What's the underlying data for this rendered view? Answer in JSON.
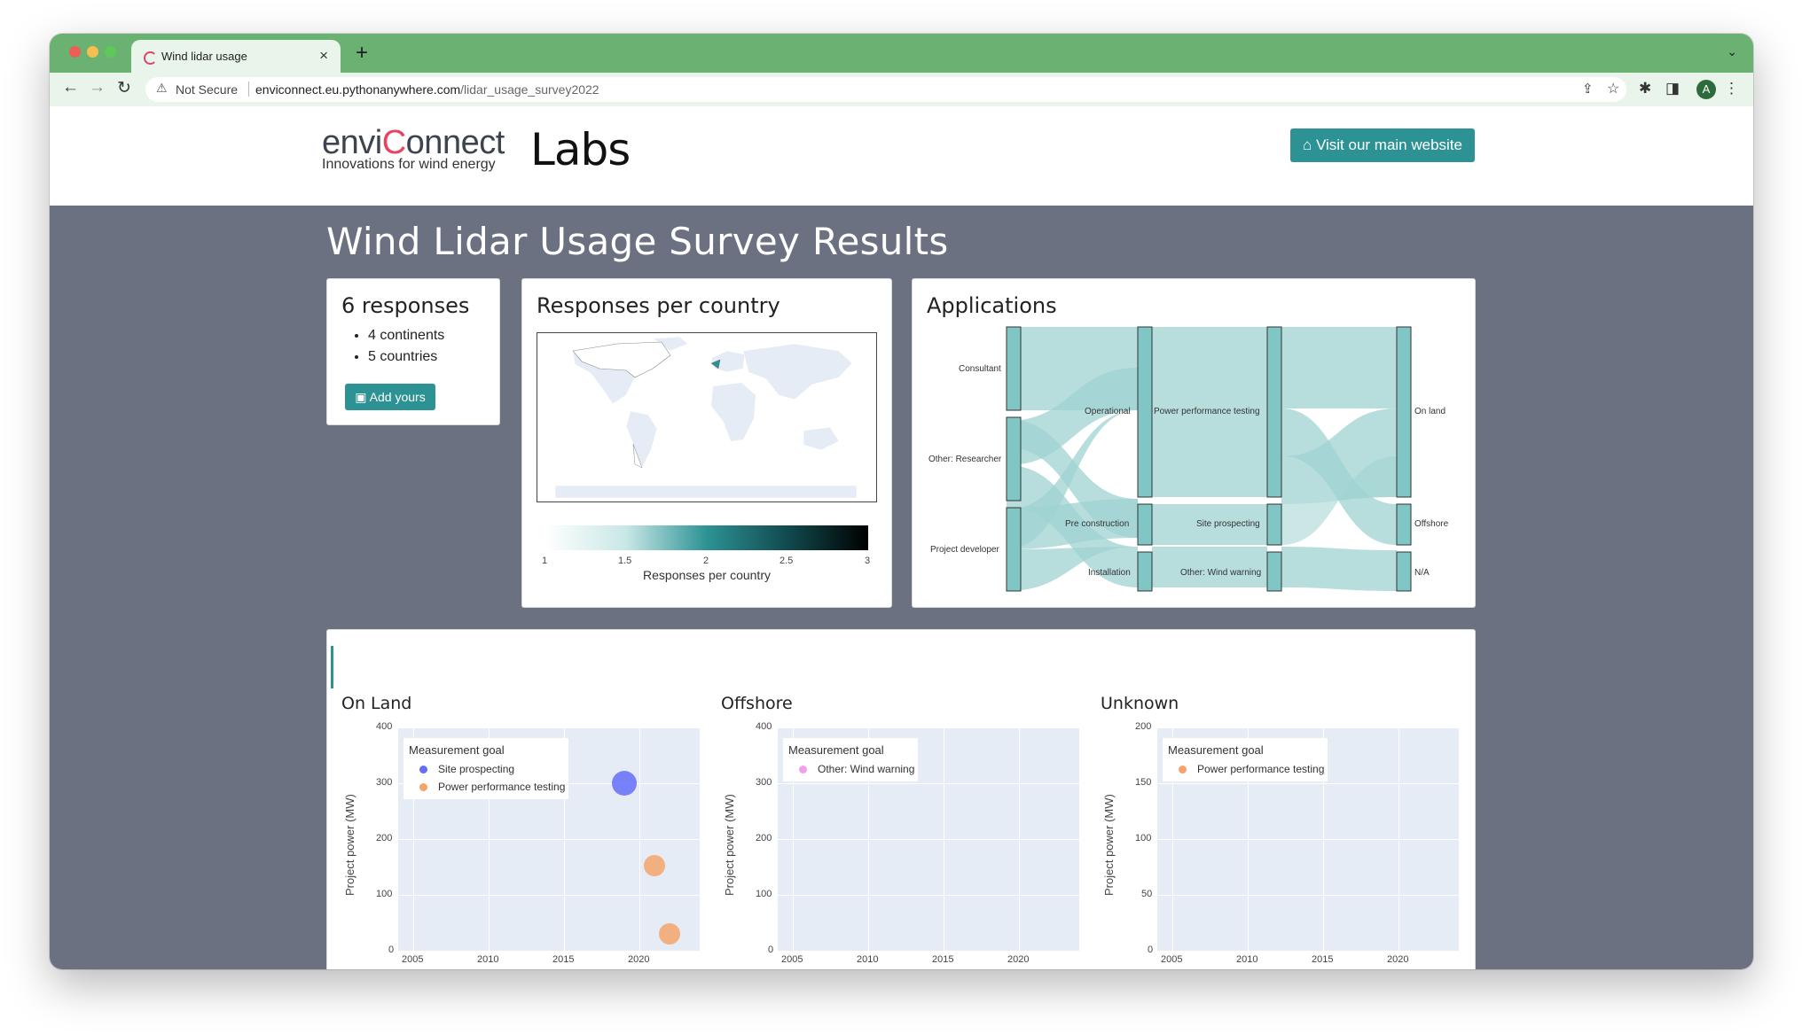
{
  "browser": {
    "tab_title": "Wind lidar usage",
    "not_secure": "Not Secure",
    "url_host": "enviconnect.eu.pythonanywhere.com",
    "url_path": "/lidar_usage_survey2022",
    "avatar_initial": "A"
  },
  "header": {
    "brand_pre": "envi",
    "brand_c": "C",
    "brand_post": "onnect",
    "tagline": "Innovations for wind energy",
    "labs": "Labs",
    "main_site_button": "Visit our main website"
  },
  "page_title": "Wind Lidar Usage Survey Results",
  "summary": {
    "responses": "6 responses",
    "continents": "4 continents",
    "countries": "5 countries",
    "add_button": "Add yours"
  },
  "country_card": {
    "title": "Responses per country",
    "colorbar_title": "Responses per country",
    "colorbar_ticks": [
      "1",
      "1.5",
      "2",
      "2.5",
      "3"
    ]
  },
  "applications": {
    "title": "Applications",
    "nodes": {
      "consultant": "Consultant",
      "researcher": "Other: Researcher",
      "developer": "Project developer",
      "operational": "Operational",
      "preconstruction": "Pre construction",
      "installation": "Installation",
      "ppt": "Power performance testing",
      "site": "Site prospecting",
      "windwarning": "Other: Wind warning",
      "onland": "On land",
      "offshore": "Offshore",
      "na": "N/A"
    }
  },
  "colors": {
    "accent": "#2d9294",
    "page_bg": "#6b7181",
    "sankey_link": "#9fd3d2",
    "site_prospecting": "#636efa",
    "power_performance": "#f4a46a",
    "wind_warning": "#f3a0e6"
  },
  "chart_data": [
    {
      "type": "scatter",
      "title": "On Land",
      "ylabel": "Project power (MW)",
      "xlabel": "",
      "xlim": [
        2004,
        2024
      ],
      "ylim": [
        0,
        400
      ],
      "xticks": [
        "2005",
        "2010",
        "2015",
        "2020"
      ],
      "yticks": [
        "0",
        "100",
        "200",
        "300",
        "400"
      ],
      "legend_title": "Measurement goal",
      "legend_position": "top-left",
      "series": [
        {
          "name": "Site prospecting",
          "color": "#636efa",
          "points": [
            {
              "x": 2019,
              "y": 300
            }
          ]
        },
        {
          "name": "Power performance testing",
          "color": "#f4a46a",
          "points": [
            {
              "x": 2021,
              "y": 152
            },
            {
              "x": 2022,
              "y": 30
            }
          ]
        }
      ]
    },
    {
      "type": "scatter",
      "title": "Offshore",
      "ylabel": "Project power (MW)",
      "xlabel": "",
      "xlim": [
        2004,
        2024
      ],
      "ylim": [
        0,
        400
      ],
      "xticks": [
        "2005",
        "2010",
        "2015",
        "2020"
      ],
      "yticks": [
        "0",
        "100",
        "200",
        "300",
        "400"
      ],
      "legend_title": "Measurement goal",
      "legend_position": "top-left",
      "series": [
        {
          "name": "Other: Wind warning",
          "color": "#f3a0e6",
          "points": []
        }
      ]
    },
    {
      "type": "scatter",
      "title": "Unknown",
      "ylabel": "Project power (MW)",
      "xlabel": "",
      "xlim": [
        2004,
        2024
      ],
      "ylim": [
        0,
        200
      ],
      "xticks": [
        "2005",
        "2010",
        "2015",
        "2020"
      ],
      "yticks": [
        "0",
        "50",
        "100",
        "150",
        "200"
      ],
      "legend_title": "Measurement goal",
      "legend_position": "top-left",
      "series": [
        {
          "name": "Power performance testing",
          "color": "#f4a46a",
          "points": []
        }
      ]
    }
  ]
}
